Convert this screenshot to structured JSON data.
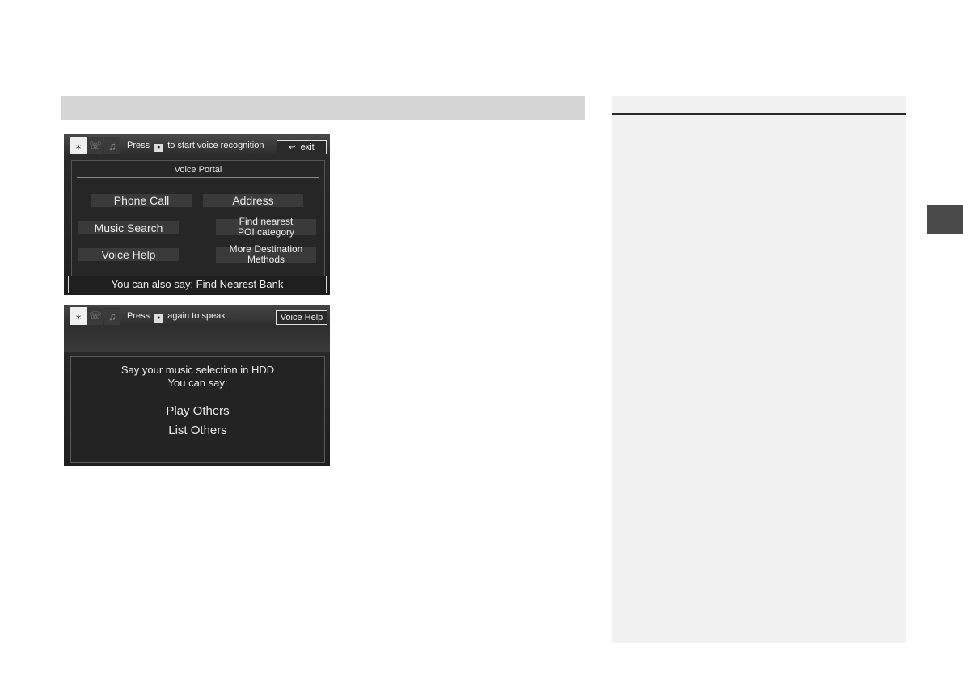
{
  "screen1": {
    "hint_before": "Press",
    "hint_key": "⚙",
    "hint_after": "to start voice recognition",
    "exit_label": "exit",
    "title": "Voice Portal",
    "options": {
      "phone_call": "Phone Call",
      "address": "Address",
      "music_search": "Music Search",
      "find_nearest_line1": "Find nearest",
      "find_nearest_line2": "POI category",
      "voice_help": "Voice Help",
      "more_dest_line1": "More Destination",
      "more_dest_line2": "Methods"
    },
    "footer": "You can also say: Find Nearest Bank"
  },
  "screen2": {
    "hint_before": "Press",
    "hint_key": "⚙",
    "hint_after": "again to speak",
    "voice_help_label": "Voice Help",
    "line1": "Say your music selection in HDD",
    "line2": "You can say:",
    "line3": "Play Others",
    "line4": "List Others"
  },
  "icons": {
    "voice": "voice-icon",
    "phone": "phone-icon",
    "music": "music-icon",
    "return": "return-icon",
    "talk_key": "talk-button-icon"
  }
}
